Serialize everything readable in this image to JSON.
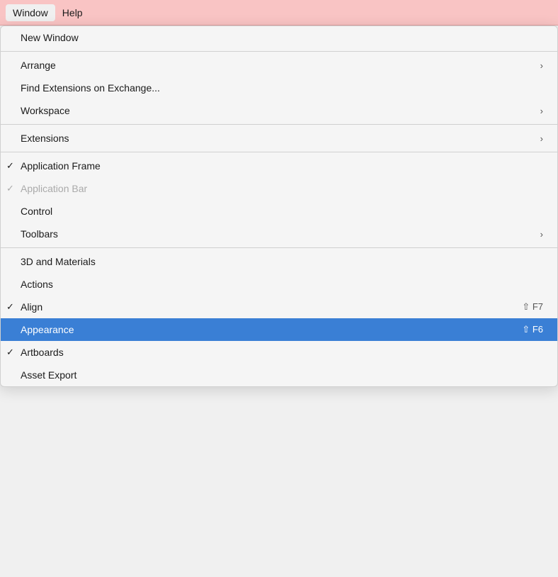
{
  "menuBar": {
    "items": [
      {
        "label": "Window",
        "active": true
      },
      {
        "label": "Help",
        "active": false
      }
    ]
  },
  "dropdown": {
    "items": [
      {
        "id": "new-window",
        "label": "New Window",
        "checkmark": "",
        "shortcut": "",
        "arrow": "",
        "disabled": false,
        "highlighted": false,
        "dividerAfter": true
      },
      {
        "id": "arrange",
        "label": "Arrange",
        "checkmark": "",
        "shortcut": "",
        "arrow": "›",
        "disabled": false,
        "highlighted": false,
        "dividerAfter": false
      },
      {
        "id": "find-extensions",
        "label": "Find Extensions on Exchange...",
        "checkmark": "",
        "shortcut": "",
        "arrow": "",
        "disabled": false,
        "highlighted": false,
        "dividerAfter": false
      },
      {
        "id": "workspace",
        "label": "Workspace",
        "checkmark": "",
        "shortcut": "",
        "arrow": "›",
        "disabled": false,
        "highlighted": false,
        "dividerAfter": true
      },
      {
        "id": "extensions",
        "label": "Extensions",
        "checkmark": "",
        "shortcut": "",
        "arrow": "›",
        "disabled": false,
        "highlighted": false,
        "dividerAfter": true
      },
      {
        "id": "application-frame",
        "label": "Application Frame",
        "checkmark": "✓",
        "shortcut": "",
        "arrow": "",
        "disabled": false,
        "highlighted": false,
        "dividerAfter": false
      },
      {
        "id": "application-bar",
        "label": "Application Bar",
        "checkmark": "✓",
        "shortcut": "",
        "arrow": "",
        "disabled": true,
        "highlighted": false,
        "dividerAfter": false
      },
      {
        "id": "control",
        "label": "Control",
        "checkmark": "",
        "shortcut": "",
        "arrow": "",
        "disabled": false,
        "highlighted": false,
        "dividerAfter": false
      },
      {
        "id": "toolbars",
        "label": "Toolbars",
        "checkmark": "",
        "shortcut": "",
        "arrow": "›",
        "disabled": false,
        "highlighted": false,
        "dividerAfter": true
      },
      {
        "id": "3d-materials",
        "label": "3D and Materials",
        "checkmark": "",
        "shortcut": "",
        "arrow": "",
        "disabled": false,
        "highlighted": false,
        "dividerAfter": false
      },
      {
        "id": "actions",
        "label": "Actions",
        "checkmark": "",
        "shortcut": "",
        "arrow": "",
        "disabled": false,
        "highlighted": false,
        "dividerAfter": false
      },
      {
        "id": "align",
        "label": "Align",
        "checkmark": "✓",
        "shortcut": "⇧ F7",
        "arrow": "",
        "disabled": false,
        "highlighted": false,
        "dividerAfter": false
      },
      {
        "id": "appearance",
        "label": "Appearance",
        "checkmark": "",
        "shortcut": "⇧ F6",
        "arrow": "",
        "disabled": false,
        "highlighted": true,
        "dividerAfter": false
      },
      {
        "id": "artboards",
        "label": "Artboards",
        "checkmark": "✓",
        "shortcut": "",
        "arrow": "",
        "disabled": false,
        "highlighted": false,
        "dividerAfter": false
      },
      {
        "id": "asset-export",
        "label": "Asset Export",
        "checkmark": "",
        "shortcut": "",
        "arrow": "",
        "disabled": false,
        "highlighted": false,
        "dividerAfter": false
      }
    ]
  }
}
